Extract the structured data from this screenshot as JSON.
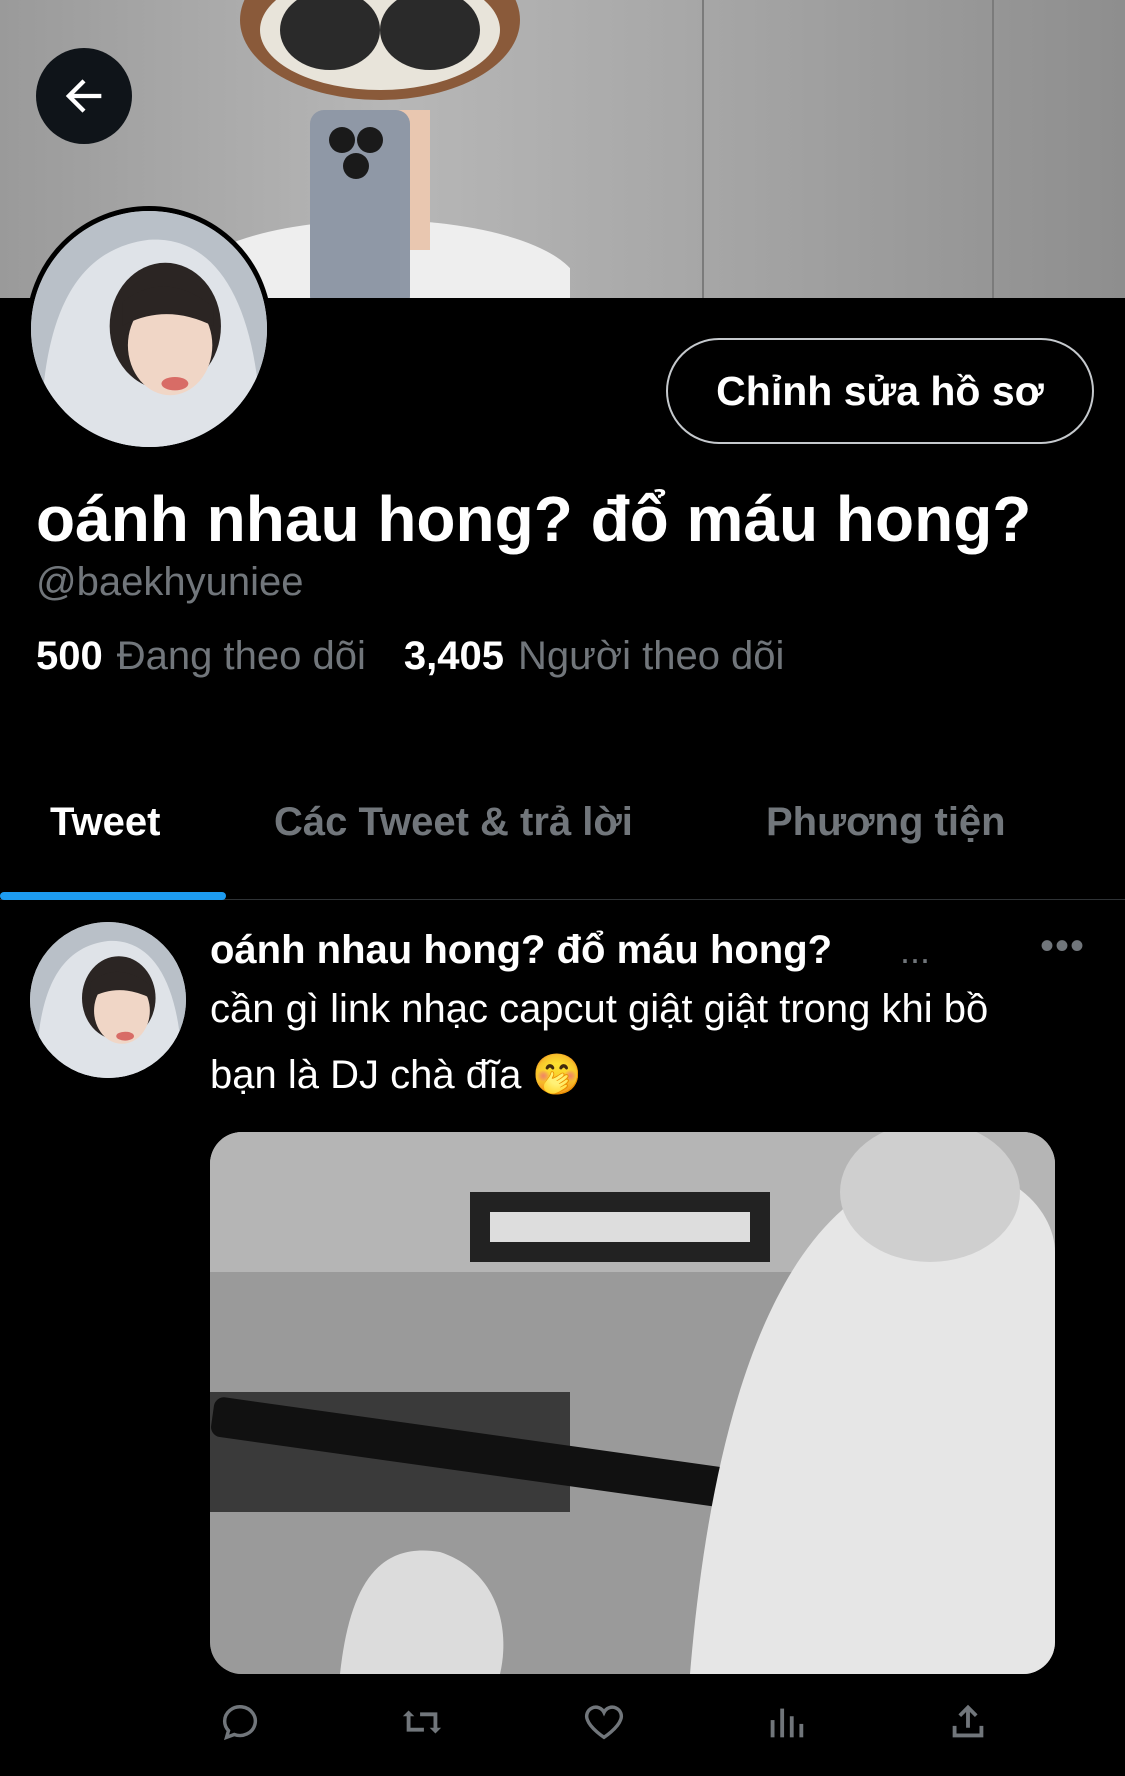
{
  "header": {
    "back_icon": "arrow-left-icon"
  },
  "profile": {
    "edit_button_label": "Chỉnh sửa hồ sơ",
    "display_name": "oánh nhau hong? đổ máu hong?",
    "handle": "@baekhyuniee",
    "following_count": "500",
    "following_label": "Đang theo dõi",
    "followers_count": "3,405",
    "followers_label": "Người theo dõi"
  },
  "tabs": [
    {
      "label": "Tweet",
      "active": true
    },
    {
      "label": "Các Tweet & trả lời",
      "active": false
    },
    {
      "label": "Phương tiện",
      "active": false
    }
  ],
  "tweet": {
    "author_name": "oánh nhau hong? đổ máu hong?",
    "name_ellipsis": "...",
    "more_label": "•••",
    "text": "cần gì link nhạc capcut giật giật trong khi bồ bạn là DJ chà đĩa 🤭",
    "actions": [
      "reply-icon",
      "retweet-icon",
      "like-icon",
      "analytics-icon",
      "share-icon"
    ]
  },
  "colors": {
    "accent": "#1d9bf0",
    "background": "#000000",
    "secondary_text": "#71767b"
  }
}
